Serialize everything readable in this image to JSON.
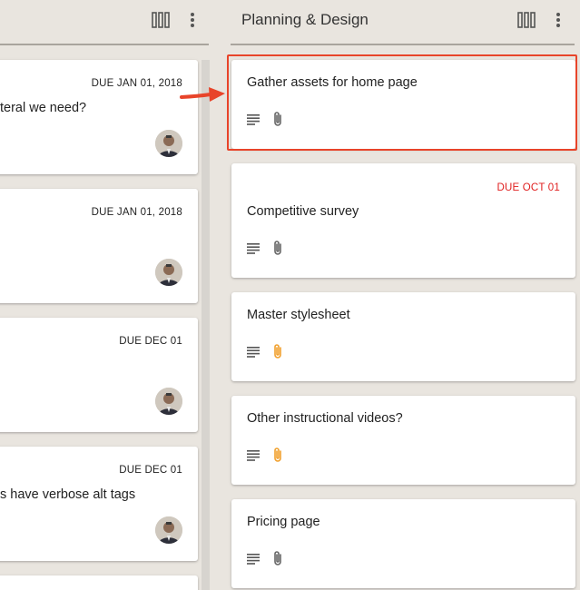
{
  "colors": {
    "background": "#e9e5df",
    "card": "#ffffff",
    "overdue": "#e02020",
    "attachment_active": "#f1a02d",
    "attachment_default": "#666666",
    "highlight": "#e8442a"
  },
  "left_column": {
    "cards": [
      {
        "due": "DUE JAN 01, 2018",
        "title": "teral we need?"
      },
      {
        "due": "DUE JAN 01, 2018",
        "title": ""
      },
      {
        "due": "DUE DEC 01",
        "title": ""
      },
      {
        "due": "DUE DEC 01",
        "title": "s have verbose alt tags"
      }
    ]
  },
  "right_column": {
    "title": "Planning & Design",
    "cards": [
      {
        "due": "",
        "title": "Gather assets for home page",
        "attachment_color": "default"
      },
      {
        "due": "DUE OCT 01",
        "title": "Competitive survey",
        "attachment_color": "default"
      },
      {
        "due": "",
        "title": "Master stylesheet",
        "attachment_color": "active"
      },
      {
        "due": "",
        "title": "Other instructional videos?",
        "attachment_color": "active"
      },
      {
        "due": "",
        "title": "Pricing page",
        "attachment_color": "default"
      }
    ]
  },
  "icons": {
    "columns": "view-column-icon",
    "more": "more-vert-icon",
    "description": "notes-icon",
    "attachment": "paperclip-icon",
    "arrow": "red-arrow-annotation"
  }
}
